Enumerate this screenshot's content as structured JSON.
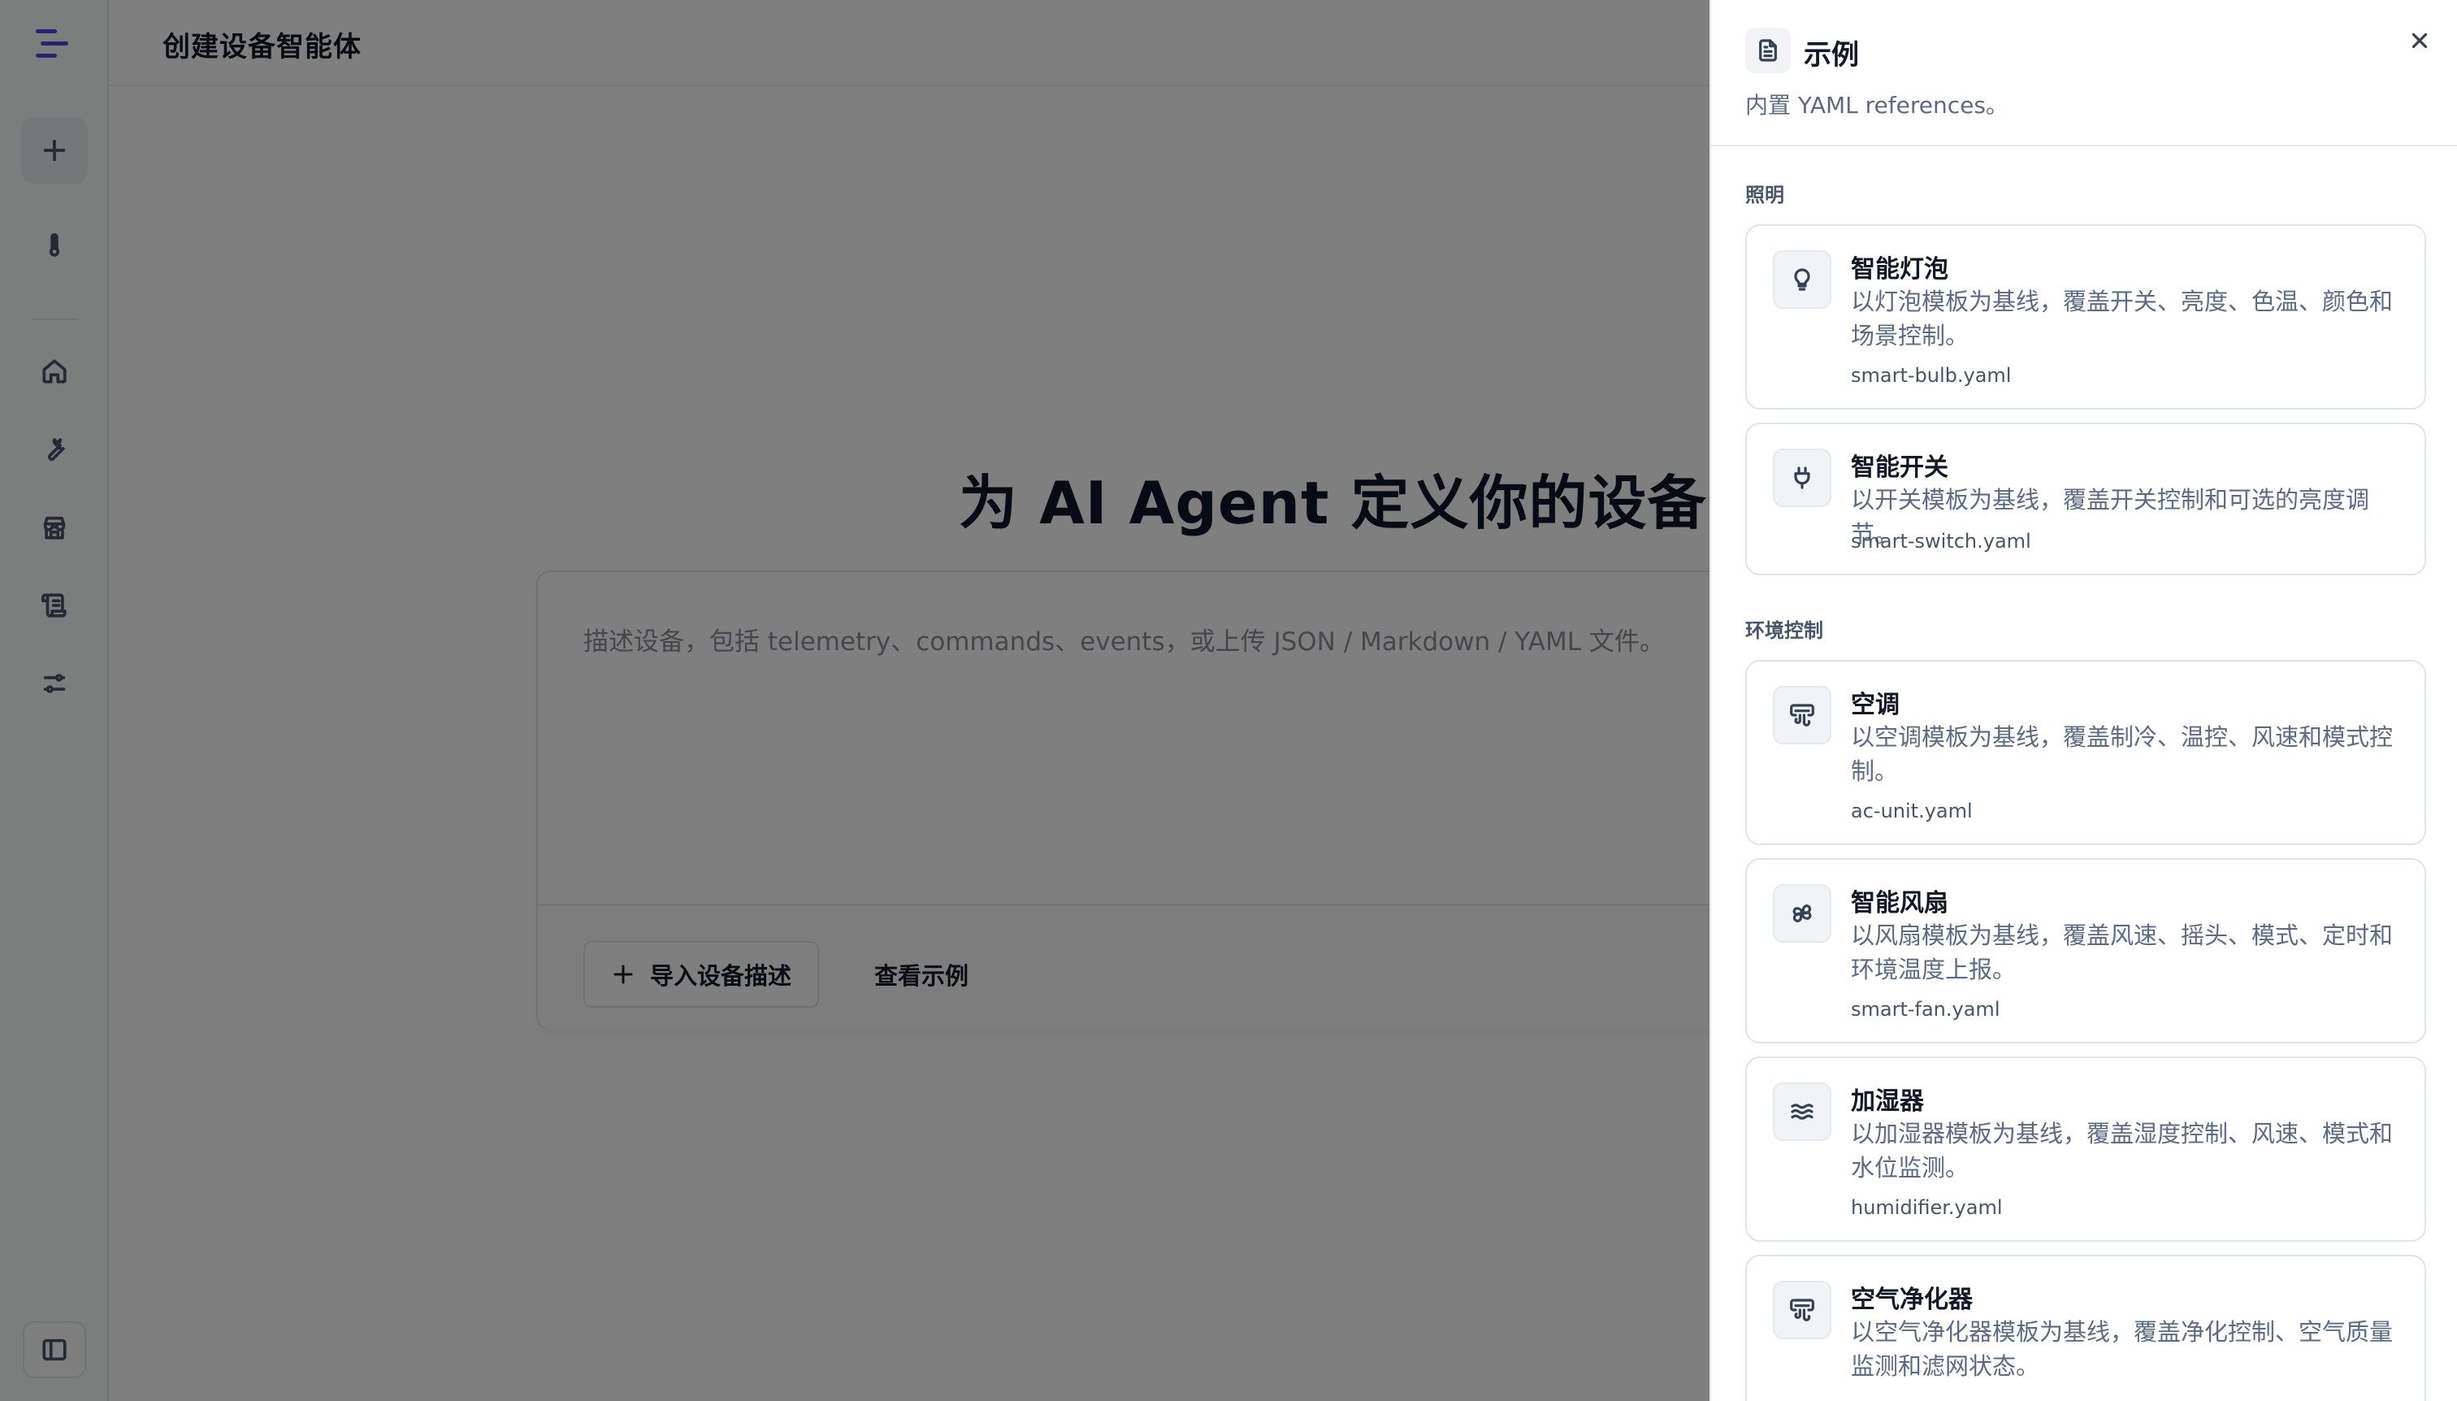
{
  "header": {
    "title": "创建设备智能体"
  },
  "main": {
    "hero_title": "为 AI Agent 定义你的设备",
    "composer_placeholder": "描述设备，包括 telemetry、commands、events，或上传 JSON / Markdown / YAML 文件。",
    "import_label": "导入设备描述",
    "view_examples_label": "查看示例"
  },
  "rail": {
    "icons": [
      "menu-logo-icon",
      "plus-icon",
      "thermometer-icon",
      "home-icon",
      "wrench-icon",
      "store-icon",
      "scroll-icon",
      "sliders-icon",
      "sidebar-toggle-icon"
    ]
  },
  "drawer": {
    "title": "示例",
    "subtitle": "内置 YAML references。",
    "groups": [
      {
        "label": "照明",
        "items": [
          {
            "icon": "lightbulb-icon",
            "title": "智能灯泡",
            "desc": "以灯泡模板为基线，覆盖开关、亮度、色温、颜色和场景控制。",
            "file": "smart-bulb.yaml"
          },
          {
            "icon": "plug-icon",
            "title": "智能开关",
            "desc": "以开关模板为基线，覆盖开关控制和可选的亮度调节。",
            "file": "smart-switch.yaml"
          }
        ]
      },
      {
        "label": "环境控制",
        "items": [
          {
            "icon": "air-vent-icon",
            "title": "空调",
            "desc": "以空调模板为基线，覆盖制冷、温控、风速和模式控制。",
            "file": "ac-unit.yaml"
          },
          {
            "icon": "fan-icon",
            "title": "智能风扇",
            "desc": "以风扇模板为基线，覆盖风速、摇头、模式、定时和环境温度上报。",
            "file": "smart-fan.yaml"
          },
          {
            "icon": "waves-icon",
            "title": "加湿器",
            "desc": "以加湿器模板为基线，覆盖湿度控制、风速、模式和水位监测。",
            "file": "humidifier.yaml"
          },
          {
            "icon": "air-vent-icon",
            "title": "空气净化器",
            "desc": "以空气净化器模板为基线，覆盖净化控制、空气质量监测和滤网状态。",
            "file": ""
          }
        ]
      }
    ]
  },
  "colors": {
    "accent": "#4f46e5",
    "overlay": "rgba(0,0,0,0.5)"
  }
}
